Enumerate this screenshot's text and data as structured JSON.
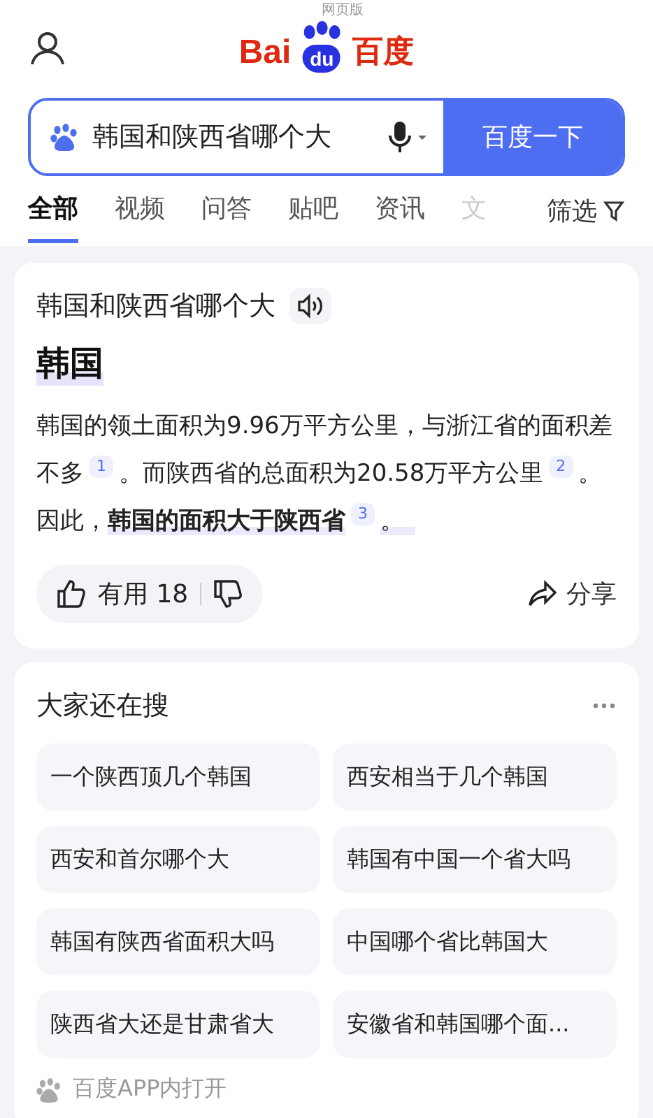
{
  "header": {
    "logo": {
      "left": "Bai",
      "mid": "du",
      "right": "百度",
      "tag": "网页版"
    }
  },
  "search": {
    "value": "韩国和陕西省哪个大",
    "button": "百度一下"
  },
  "tabs": [
    {
      "label": "全部",
      "selected": true
    },
    {
      "label": "视频",
      "selected": false
    },
    {
      "label": "问答",
      "selected": false
    },
    {
      "label": "贴吧",
      "selected": false
    },
    {
      "label": "资讯",
      "selected": false
    },
    {
      "label": "文",
      "selected": false,
      "faded": true
    }
  ],
  "filter": "筛选",
  "answer": {
    "question": "韩国和陕西省哪个大",
    "result": "韩国",
    "segments": [
      {
        "kind": "plain",
        "text": "韩国的领土面积为9.96万平方公里，与浙江省的面积差不多"
      },
      {
        "kind": "cite",
        "text": "1"
      },
      {
        "kind": "plain",
        "text": "。而陕西省的总面积为20.58万平方公里"
      },
      {
        "kind": "cite",
        "text": "2"
      },
      {
        "kind": "plain",
        "text": "。因此，"
      },
      {
        "kind": "bold",
        "text": "韩国的面积大于陕西省"
      },
      {
        "kind": "cite",
        "text": "3"
      },
      {
        "kind": "mark",
        "text": "。"
      }
    ],
    "useful": "有用",
    "useful_count": "18",
    "share": "分享"
  },
  "related": {
    "title": "大家还在搜",
    "items": [
      "一个陕西顶几个韩国",
      "西安相当于几个韩国",
      "西安和首尔哪个大",
      "韩国有中国一个省大吗",
      "韩国有陕西省面积大吗",
      "中国哪个省比韩国大",
      "陕西省大还是甘肃省大",
      "安徽省和韩国哪个面..."
    ]
  },
  "footer": "百度APP内打开"
}
